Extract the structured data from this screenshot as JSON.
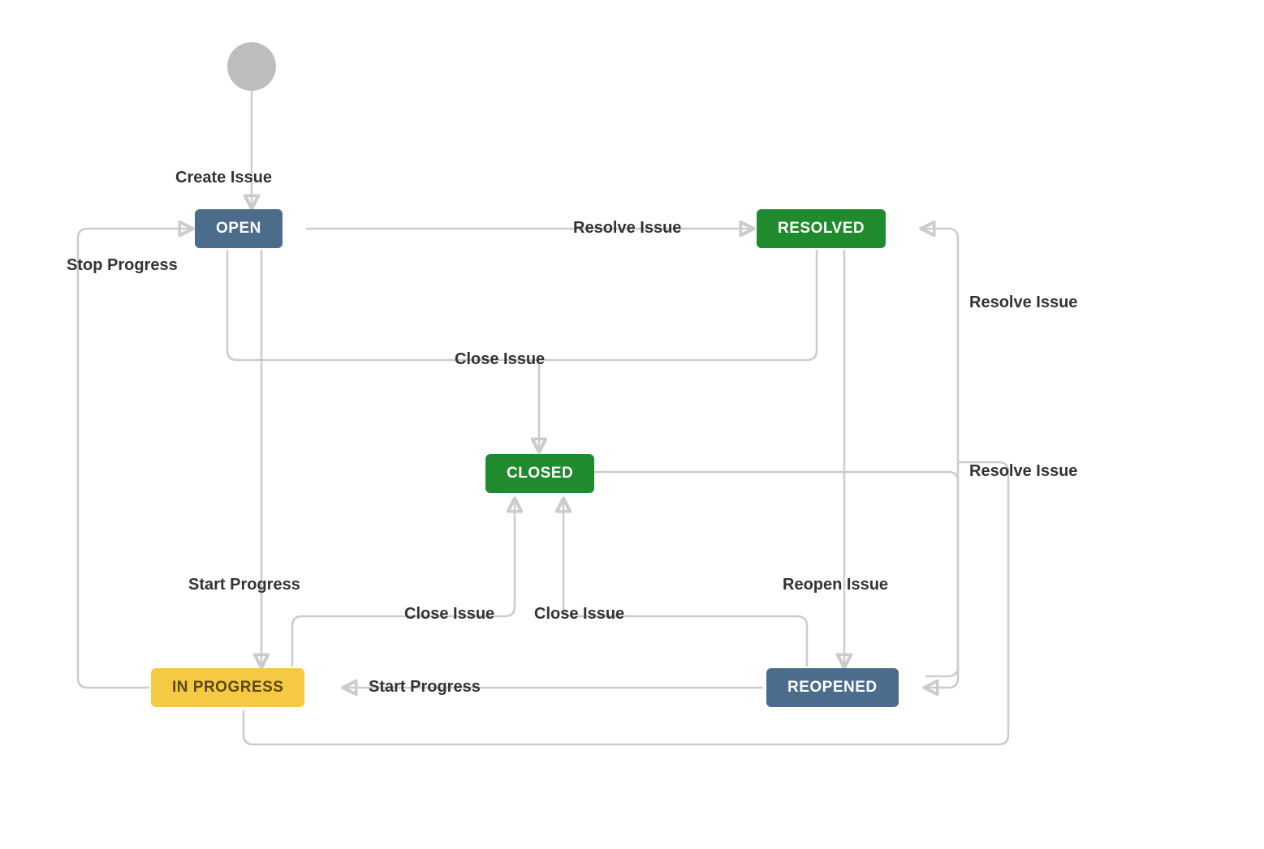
{
  "nodes": {
    "open": "OPEN",
    "resolved": "RESOLVED",
    "closed": "CLOSED",
    "in_progress": "IN PROGRESS",
    "reopened": "REOPENED"
  },
  "edges": {
    "create_issue": "Create Issue",
    "resolve_issue_1": "Resolve Issue",
    "resolve_issue_2": "Resolve Issue",
    "resolve_issue_3": "Resolve Issue",
    "stop_progress": "Stop Progress",
    "close_issue_1": "Close Issue",
    "close_issue_2": "Close Issue",
    "close_issue_3": "Close Issue",
    "start_progress_1": "Start Progress",
    "start_progress_2": "Start Progress",
    "reopen_issue": "Reopen Issue"
  },
  "colors": {
    "blue": "#4c6c8c",
    "green": "#208a2e",
    "yellow": "#f6c945",
    "grey": "#bdbdbd",
    "edge": "#cccccc",
    "label": "#333333"
  }
}
